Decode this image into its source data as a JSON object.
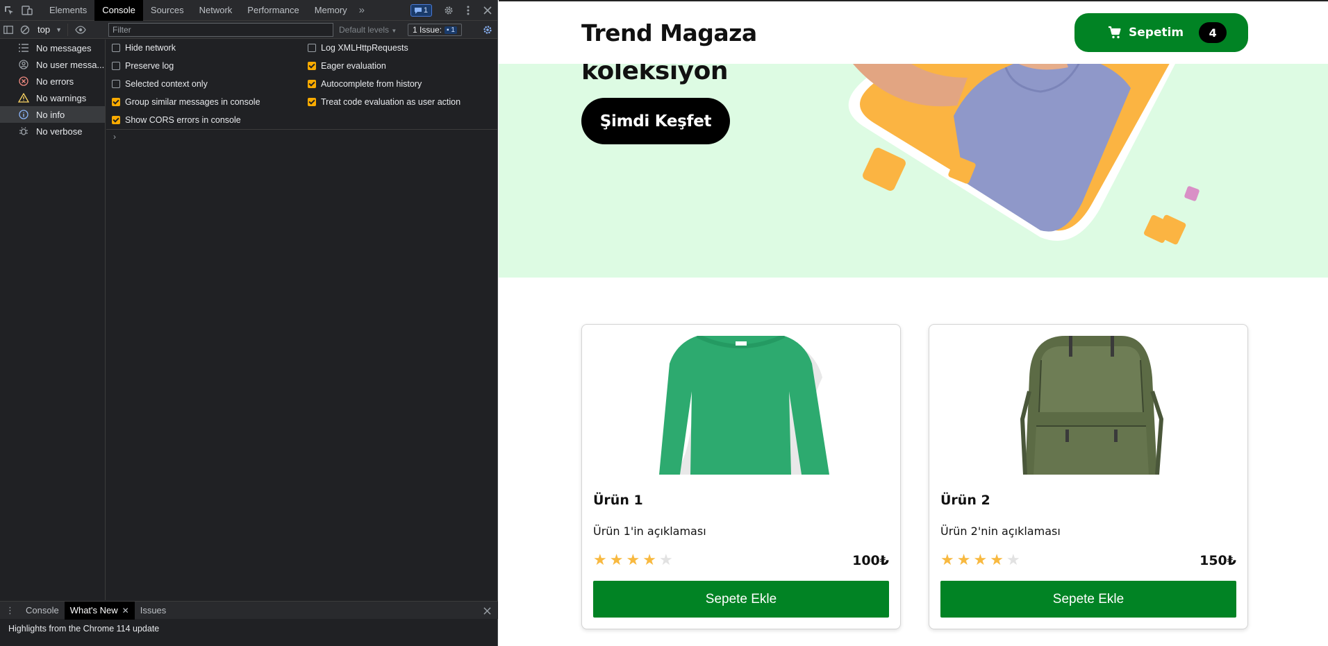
{
  "devtools": {
    "tabs": [
      "Elements",
      "Console",
      "Sources",
      "Network",
      "Performance",
      "Memory"
    ],
    "active_tab": "Console",
    "issues_badge": "1",
    "context": "top",
    "filter_placeholder": "Filter",
    "levels": "Default levels",
    "issue_pill_label": "1 Issue:",
    "issue_pill_count": "1",
    "sidebar": [
      {
        "label": "No messages",
        "icon": "list-icon"
      },
      {
        "label": "No user messa...",
        "icon": "user-icon"
      },
      {
        "label": "No errors",
        "icon": "error-icon"
      },
      {
        "label": "No warnings",
        "icon": "warning-icon"
      },
      {
        "label": "No info",
        "icon": "info-icon"
      },
      {
        "label": "No verbose",
        "icon": "bug-icon"
      }
    ],
    "options_left": [
      {
        "label": "Hide network",
        "checked": false
      },
      {
        "label": "Preserve log",
        "checked": false
      },
      {
        "label": "Selected context only",
        "checked": false
      },
      {
        "label": "Group similar messages in console",
        "checked": true
      },
      {
        "label": "Show CORS errors in console",
        "checked": true
      }
    ],
    "options_right": [
      {
        "label": "Log XMLHttpRequests",
        "checked": false
      },
      {
        "label": "Eager evaluation",
        "checked": true
      },
      {
        "label": "Autocomplete from history",
        "checked": true
      },
      {
        "label": "Treat code evaluation as user action",
        "checked": true
      }
    ],
    "drawer_tabs": [
      "Console",
      "What's New",
      "Issues"
    ],
    "drawer_active": "What's New",
    "highlights": "Highlights from the Chrome 114 update",
    "accent": "#f9ab00"
  },
  "site": {
    "brand": "Trend Magaza",
    "cart_label": "Sepetim",
    "cart_count": "4",
    "hero_text": "koleksiyon",
    "cta": "Şimdi Keşfet",
    "accent_green": "#018324",
    "hero_bg": "#ddfbe3",
    "products": [
      {
        "title": "Ürün 1",
        "desc": "Ürün 1'in açıklaması",
        "price": "100₺",
        "rating": 4,
        "max_rating": 5,
        "button": "Sepete Ekle",
        "image": "green-sweater"
      },
      {
        "title": "Ürün 2",
        "desc": "Ürün 2'nin açıklaması",
        "price": "150₺",
        "rating": 4,
        "max_rating": 5,
        "button": "Sepete Ekle",
        "image": "olive-backpack"
      }
    ]
  }
}
